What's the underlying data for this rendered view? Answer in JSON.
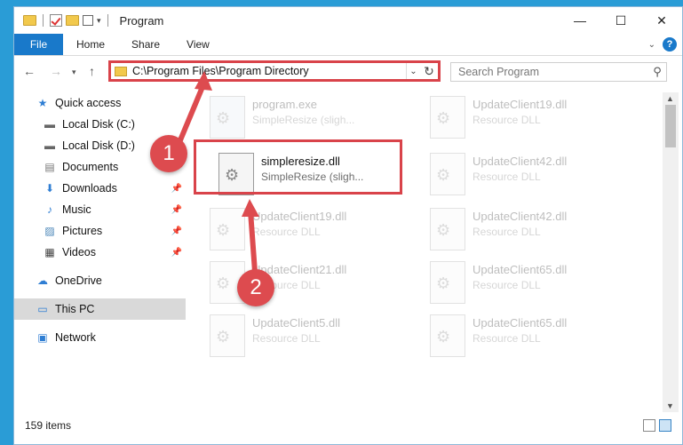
{
  "window": {
    "title": "Program"
  },
  "ribbon": {
    "tabs": [
      "File",
      "Home",
      "Share",
      "View"
    ]
  },
  "address": {
    "path": "C:\\Program Files\\Program Directory",
    "search_placeholder": "Search Program"
  },
  "sidebar": {
    "items": [
      {
        "label": "Quick access",
        "icon": "star-icon"
      },
      {
        "label": "Local Disk (C:)",
        "icon": "drive-icon"
      },
      {
        "label": "Local Disk (D:)",
        "icon": "drive-icon"
      },
      {
        "label": "Documents",
        "icon": "document-icon"
      },
      {
        "label": "Downloads",
        "icon": "download-icon"
      },
      {
        "label": "Music",
        "icon": "music-icon"
      },
      {
        "label": "Pictures",
        "icon": "picture-icon"
      },
      {
        "label": "Videos",
        "icon": "video-icon"
      },
      {
        "label": "OneDrive",
        "icon": "cloud-icon"
      },
      {
        "label": "This PC",
        "icon": "computer-icon"
      },
      {
        "label": "Network",
        "icon": "network-icon"
      }
    ]
  },
  "files": [
    {
      "name": "program.exe",
      "desc": "SimpleResize (sligh..."
    },
    {
      "name": "UpdateClient19.dll",
      "desc": "Resource DLL"
    },
    {
      "name": "simpleresize.dll",
      "desc": "SimpleResize (sligh..."
    },
    {
      "name": "UpdateClient42.dll",
      "desc": "Resource DLL"
    },
    {
      "name": "UpdateClient19.dll",
      "desc": "Resource DLL"
    },
    {
      "name": "UpdateClient42.dll",
      "desc": "Resource DLL"
    },
    {
      "name": "UpdateClient21.dll",
      "desc": "Resource DLL"
    },
    {
      "name": "UpdateClient65.dll",
      "desc": "Resource DLL"
    },
    {
      "name": "UpdateClient5.dll",
      "desc": "Resource DLL"
    },
    {
      "name": "UpdateClient65.dll",
      "desc": "Resource DLL"
    }
  ],
  "status": {
    "count": "159 items"
  },
  "annotations": {
    "step1": "1",
    "step2": "2"
  },
  "colors": {
    "accent": "#1979ca",
    "highlight": "#d9434a"
  }
}
